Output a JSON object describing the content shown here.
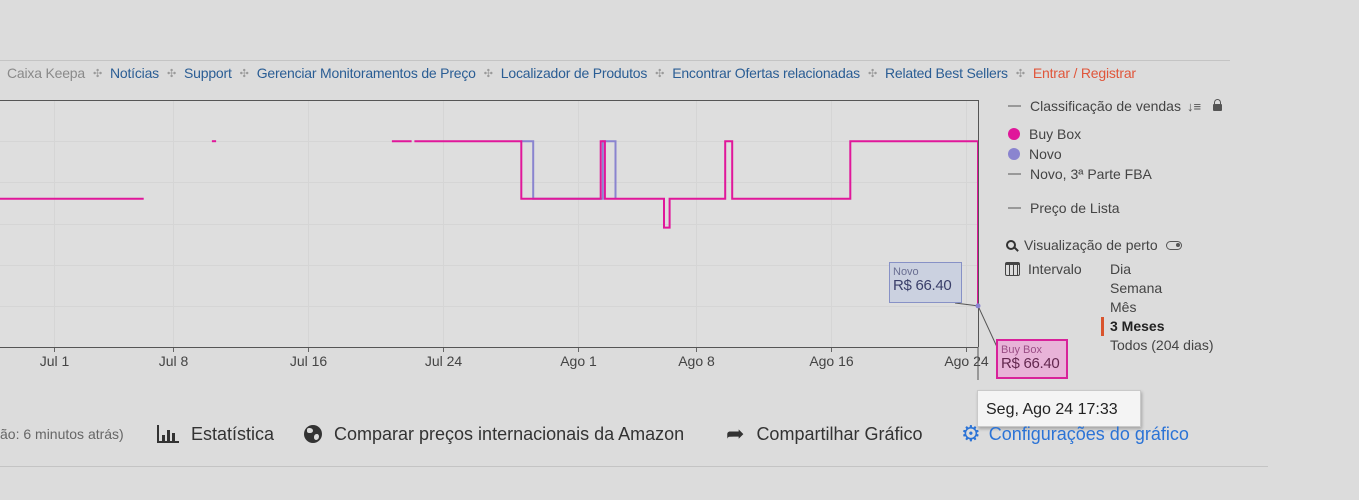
{
  "nav": {
    "items": [
      "Caixa Keepa",
      "Notícias",
      "Support",
      "Gerenciar Monitoramentos de Preço",
      "Localizador de Produtos",
      "Encontrar Ofertas relacionadas",
      "Related Best Sellers",
      "Entrar / Registrar"
    ],
    "separator": "✣"
  },
  "legend": {
    "sales_rank": "Classificação de vendas",
    "sort_icon": "sort-icon",
    "buy_box": "Buy Box",
    "new": "Novo",
    "new_fba": "Novo, 3ª Parte FBA",
    "list_price": "Preço de Lista",
    "close_view": "Visualização de perto",
    "range_label": "Intervalo",
    "ranges": [
      "Dia",
      "Semana",
      "Mês",
      "3 Meses",
      "Todos (204 dias)"
    ],
    "active_range": "3 Meses"
  },
  "tooltips": {
    "new_label": "Novo",
    "new_price": "R$ 66.40",
    "buybox_label": "Buy Box",
    "buybox_price": "R$ 66.40",
    "date": "Seg, Ago 24 17:33"
  },
  "toolbar": {
    "status": "ão: 6 minutos atrás)",
    "stats": "Estatística",
    "compare": "Comparar preços internacionais da Amazon",
    "share": "Compartilhar Gráfico",
    "settings": "Configurações do gráfico"
  },
  "colors": {
    "buy_box": "#e0179a",
    "new": "#8a84cf",
    "grid": "#d5d5d5",
    "plot_bg": "#dedede",
    "accent_link": "#2b73d6",
    "active_range": "#d9542d"
  },
  "chart_data": {
    "type": "line",
    "xlabel": "",
    "ylabel": "",
    "x_domain": [
      "2020-06-26",
      "2020-08-24T17:33"
    ],
    "x_ticks": [
      {
        "label": "Jul 1",
        "date": "2020-07-01"
      },
      {
        "label": "Jul 8",
        "date": "2020-07-08"
      },
      {
        "label": "Jul 16",
        "date": "2020-07-16"
      },
      {
        "label": "Jul 24",
        "date": "2020-07-24"
      },
      {
        "label": "Ago 1",
        "date": "2020-08-01"
      },
      {
        "label": "Ago 8",
        "date": "2020-08-08"
      },
      {
        "label": "Ago 16",
        "date": "2020-08-16"
      },
      {
        "label": "Ago 24",
        "date": "2020-08-24"
      }
    ],
    "ylim": [
      0,
      6
    ],
    "y_gridlines": [
      1,
      2,
      3,
      4,
      5
    ],
    "series": [
      {
        "name": "Novo",
        "color": "#8a84cf",
        "segments": [
          [
            [
              "2020-07-28T16:00",
              5.0
            ],
            [
              "2020-07-29T09:00",
              5.0
            ],
            [
              "2020-07-29T09:00",
              3.6
            ],
            [
              "2020-08-02T12:00",
              3.6
            ],
            [
              "2020-08-02T12:00",
              5.0
            ],
            [
              "2020-08-03T06:00",
              5.0
            ],
            [
              "2020-08-03T06:00",
              3.6
            ]
          ]
        ]
      },
      {
        "name": "Buy Box",
        "color": "#e0179a",
        "segments": [
          [
            [
              "2020-06-26T00:00",
              3.6
            ],
            [
              "2020-07-06T07:00",
              3.6
            ]
          ],
          [
            [
              "2020-07-10T08:00",
              5.0
            ],
            [
              "2020-07-10T14:00",
              5.0
            ]
          ],
          [
            [
              "2020-07-21T00:00",
              5.0
            ],
            [
              "2020-07-22T04:00",
              5.0
            ]
          ],
          [
            [
              "2020-07-22T08:00",
              5.0
            ],
            [
              "2020-07-28T16:00",
              5.0
            ],
            [
              "2020-07-28T16:00",
              3.6
            ],
            [
              "2020-08-02T09:00",
              3.6
            ],
            [
              "2020-08-02T09:00",
              5.0
            ],
            [
              "2020-08-02T15:00",
              5.0
            ],
            [
              "2020-08-02T15:00",
              3.6
            ],
            [
              "2020-08-06T03:00",
              3.6
            ],
            [
              "2020-08-06T03:00",
              2.9
            ],
            [
              "2020-08-06T11:00",
              2.9
            ],
            [
              "2020-08-06T11:00",
              3.6
            ],
            [
              "2020-08-09T18:00",
              3.6
            ],
            [
              "2020-08-09T18:00",
              5.0
            ],
            [
              "2020-08-10T04:00",
              5.0
            ],
            [
              "2020-08-10T04:00",
              3.6
            ],
            [
              "2020-08-17T04:00",
              3.6
            ],
            [
              "2020-08-17T04:00",
              5.0
            ],
            [
              "2020-08-24T17:33",
              5.0
            ],
            [
              "2020-08-24T17:33",
              1.0
            ]
          ]
        ]
      }
    ]
  }
}
